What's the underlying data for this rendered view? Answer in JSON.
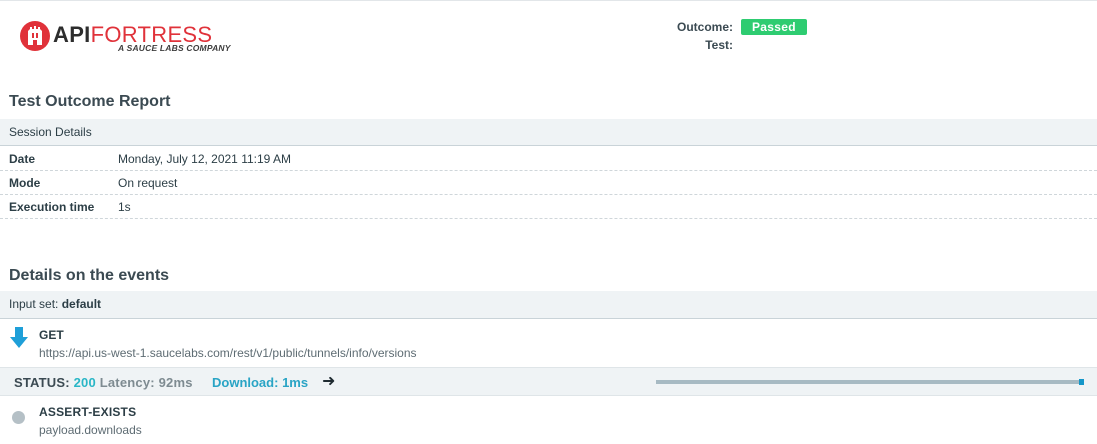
{
  "logo": {
    "word_api": "API",
    "word_fortress": "FORTRESS",
    "subtitle": "A SAUCE LABS COMPANY",
    "brand_color": "#e0323a"
  },
  "outcome": {
    "outcome_label": "Outcome:",
    "outcome_value": "Passed",
    "outcome_color": "#2ecc71",
    "test_label": "Test:",
    "test_value": ""
  },
  "report": {
    "title": "Test Outcome Report",
    "session_header": "Session Details",
    "rows": [
      {
        "key": "Date",
        "value": "Monday, July 12, 2021 11:19 AM"
      },
      {
        "key": "Mode",
        "value": "On request"
      },
      {
        "key": "Execution time",
        "value": "1s"
      }
    ]
  },
  "events": {
    "title": "Details on the events",
    "input_set_label": "Input set:",
    "input_set_value": "default",
    "request": {
      "icon": "arrow-down-icon",
      "method": "GET",
      "url": "https://api.us-west-1.saucelabs.com/rest/v1/public/tunnels/info/versions"
    },
    "status": {
      "status_label": "STATUS:",
      "status_code": "200",
      "latency_label": "Latency:",
      "latency_value": "92ms",
      "download_label": "Download:",
      "download_value": "1ms",
      "next_icon": "arrow-right-icon",
      "accent_color": "#29b6c6"
    },
    "assertion": {
      "icon": "status-dot-icon",
      "name": "ASSERT-EXISTS",
      "expression": "payload.downloads"
    }
  }
}
